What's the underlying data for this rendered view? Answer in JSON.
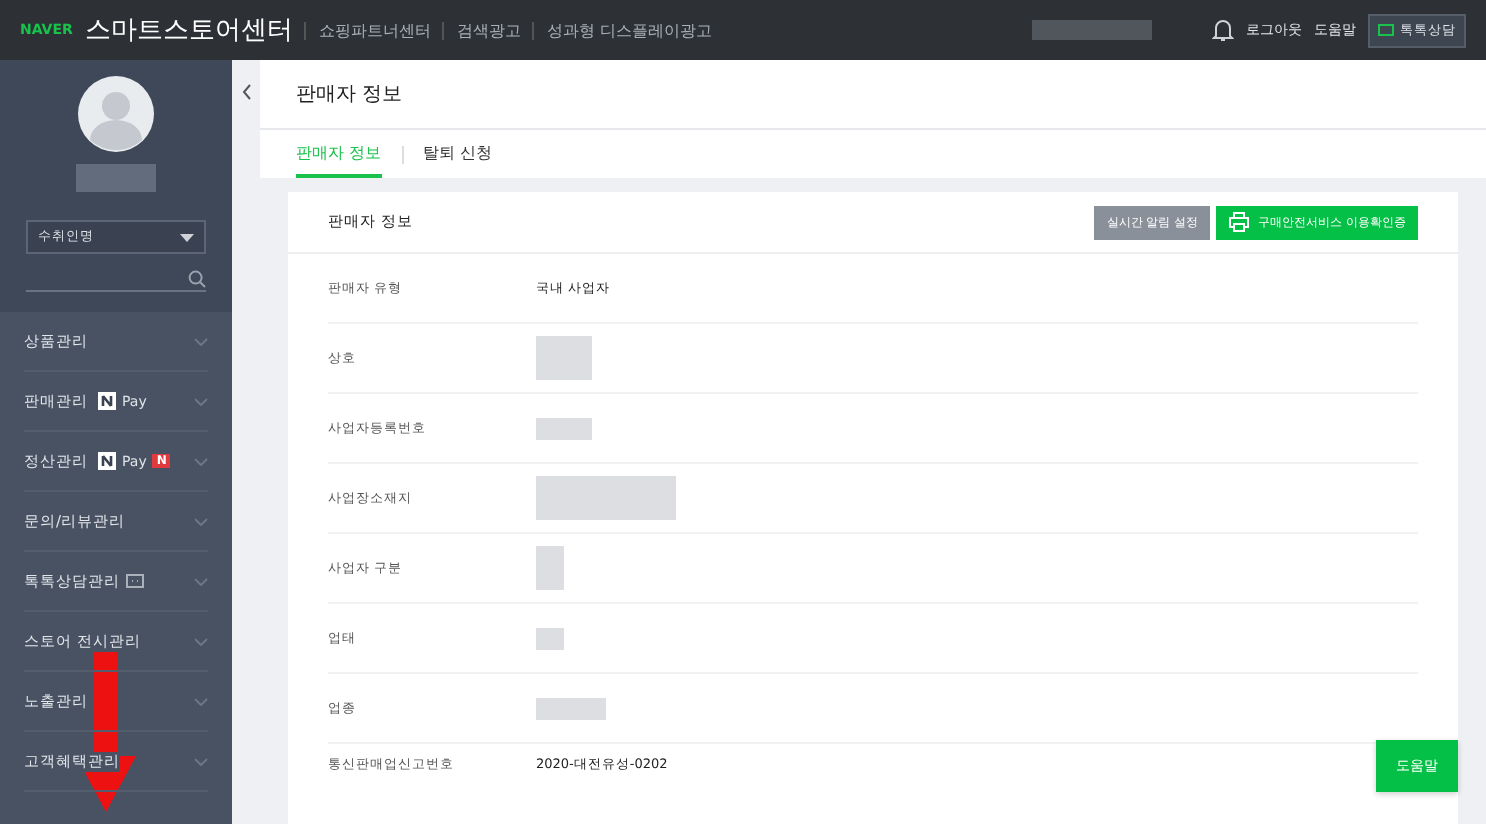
{
  "topbar": {
    "brand": "NAVER",
    "title": "스마트스토어센터",
    "links": [
      "쇼핑파트너센터",
      "검색광고",
      "성과형 디스플레이광고"
    ],
    "logout": "로그아웃",
    "help": "도움말",
    "talk_button": "톡톡상담"
  },
  "sidebar": {
    "store_select": "수취인명",
    "menu": [
      {
        "label": "상품관리"
      },
      {
        "label": "판매관리",
        "badges": [
          {
            "kind": "npay",
            "text": "Pay"
          }
        ]
      },
      {
        "label": "정산관리",
        "badges": [
          {
            "kind": "npay",
            "text": "Pay"
          },
          {
            "kind": "new",
            "text": "N"
          }
        ]
      },
      {
        "label": "문의/리뷰관리"
      },
      {
        "label": "톡톡상담관리",
        "badges": [
          {
            "kind": "chat"
          }
        ]
      },
      {
        "label": "스토어 전시관리"
      },
      {
        "label": "노출관리"
      },
      {
        "label": "고객혜택관리"
      }
    ]
  },
  "page": {
    "title": "판매자 정보",
    "tabs": [
      {
        "label": "판매자 정보",
        "selected": true
      },
      {
        "label": "탈퇴 신청",
        "selected": false
      }
    ]
  },
  "card": {
    "title": "판매자 정보",
    "buttons": [
      {
        "label": "실시간 알림 설정",
        "kind": "grey"
      },
      {
        "label": "구매안전서비스 이용확인증",
        "kind": "print"
      }
    ],
    "rows": [
      {
        "label": "판매자 유형",
        "value": "국내 사업자"
      },
      {
        "label": "상호"
      },
      {
        "label": "사업자등록번호"
      },
      {
        "label": "사업장소재지"
      },
      {
        "label": "사업자 구분"
      },
      {
        "label": "업태"
      },
      {
        "label": "업종"
      },
      {
        "label": "통신판매업신고번호",
        "value": "2020-대전유성-0202"
      }
    ]
  },
  "help_button": "도움말"
}
